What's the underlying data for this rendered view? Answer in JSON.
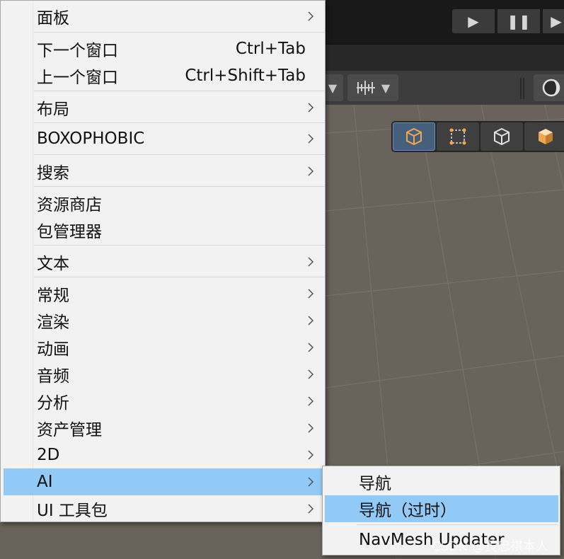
{
  "menu": {
    "items": [
      {
        "label": "面板",
        "submenu": true
      },
      {
        "label": "下一个窗口",
        "shortcut": "Ctrl+Tab"
      },
      {
        "label": "上一个窗口",
        "shortcut": "Ctrl+Shift+Tab"
      },
      {
        "label": "布局",
        "submenu": true
      },
      {
        "label": "BOXOPHOBIC",
        "submenu": true
      },
      {
        "label": "搜索",
        "submenu": true
      },
      {
        "label": "资源商店"
      },
      {
        "label": "包管理器"
      },
      {
        "label": "文本",
        "submenu": true
      },
      {
        "label": "常规",
        "submenu": true
      },
      {
        "label": "渲染",
        "submenu": true
      },
      {
        "label": "动画",
        "submenu": true
      },
      {
        "label": "音频",
        "submenu": true
      },
      {
        "label": "分析",
        "submenu": true
      },
      {
        "label": "资产管理",
        "submenu": true
      },
      {
        "label": "2D",
        "submenu": true
      },
      {
        "label": "AI",
        "submenu": true,
        "highlighted": true
      },
      {
        "label": "UI 工具包",
        "submenu": true
      }
    ]
  },
  "submenu": {
    "items": [
      {
        "label": "导航"
      },
      {
        "label": "导航（过时）",
        "highlighted": true
      },
      {
        "label": "NavMesh Updater"
      }
    ]
  },
  "watermark": "CSDN @黄忠祺本人",
  "colors": {
    "menu_bg": "#f2f2f2",
    "highlight": "#91c9f7",
    "scene_bg": "#6a635b",
    "toolbar_bg": "#3c3c3c",
    "gizmo_active": "#46607c"
  }
}
